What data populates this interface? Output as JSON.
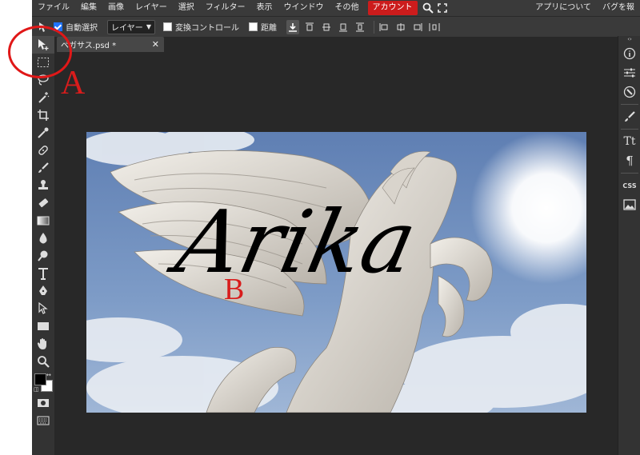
{
  "menu": {
    "items": [
      "ファイル",
      "編集",
      "画像",
      "レイヤー",
      "選択",
      "フィルター",
      "表示",
      "ウインドウ",
      "その他"
    ],
    "account_label": "アカウント",
    "right_items": [
      "アプリについて",
      "バグを報"
    ]
  },
  "options": {
    "auto_select_label": "自動選択",
    "auto_select_checked": true,
    "layer_select_value": "レイヤー",
    "transform_controls_label": "変換コントロール",
    "distance_label": "距離"
  },
  "document": {
    "tab_title": "ペガサス.psd *"
  },
  "artwork": {
    "text": "Arika"
  },
  "annotations": {
    "A": "A",
    "B": "B"
  },
  "right_panel": {
    "css_label": "CSS",
    "char_label": "Tt",
    "para_label": "¶"
  },
  "colors": {
    "accent": "#cc1c1c",
    "annotation": "#d81c1c",
    "checkbox": "#1e73ff",
    "foreground": "#000000",
    "background": "#ffffff"
  }
}
